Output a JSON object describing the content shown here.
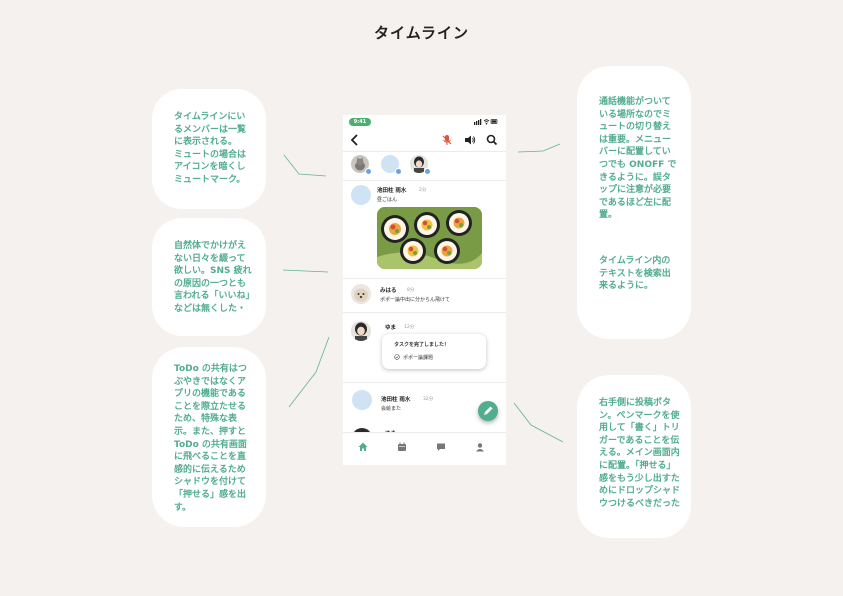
{
  "page": {
    "title": "タイムライン"
  },
  "notes": {
    "members": "タイムラインにいるメンバーは一覧に表示される。\nミュートの場合はアイコンを暗くしミュートマーク。",
    "call": "通話機能がついている場所なのでミュートの切り替えは重要。メニューバーに配置していつでも ONOFF できるように。誤タップに注意が必要であるほど左に配置。",
    "search": "タイムライン内のテキストを検索出来るように。",
    "natural": "自然体でかけがえない日々を綴って欲しい。SNS 疲れの原因の一つとも言われる「いいね」などは無くした・",
    "todo": "ToDo の共有はつぶやきではなくアプリの機能であることを際立たせるため、特殊な表示。また、押すと ToDo の共有画面に飛べることを直感的に伝えるためシャドウを付けて「押せる」感を出す。",
    "post": "右手側に投稿ボタン。ペンマークを使用して「書く」トリガーであることを伝える。メイン画面内に配置。「押せる」感をもう少し出すためにドロップシャドウつけるべきだった"
  },
  "phone": {
    "status": {
      "time": "9:41"
    },
    "icons": {
      "back": "chevron-left-icon",
      "mute": "microphone-off-icon",
      "speaker": "speaker-icon",
      "search": "search-icon"
    },
    "colors": {
      "accent": "#52ad8f",
      "status_pill": "#4caf72",
      "mute_red": "#e0533b",
      "avatar_blue": "#cfe3f5"
    },
    "posts": [
      {
        "name": "池田柱 雨水",
        "time": "2分",
        "text": "昼ごはん"
      },
      {
        "name": "みはる",
        "time": "8分",
        "text": "ポポー論中出に分からん飛けて"
      },
      {
        "name": "ゆま",
        "time": "12分",
        "todo_title": "タスクを完了しました！",
        "todo_item": "ポポー論課題"
      },
      {
        "name": "池田柱 雨水",
        "time": "32分",
        "text": "会絵また"
      },
      {
        "name": "ゆま",
        "time": ""
      }
    ],
    "tabs": [
      "home-icon",
      "calendar-icon",
      "chat-icon",
      "profile-icon"
    ]
  }
}
